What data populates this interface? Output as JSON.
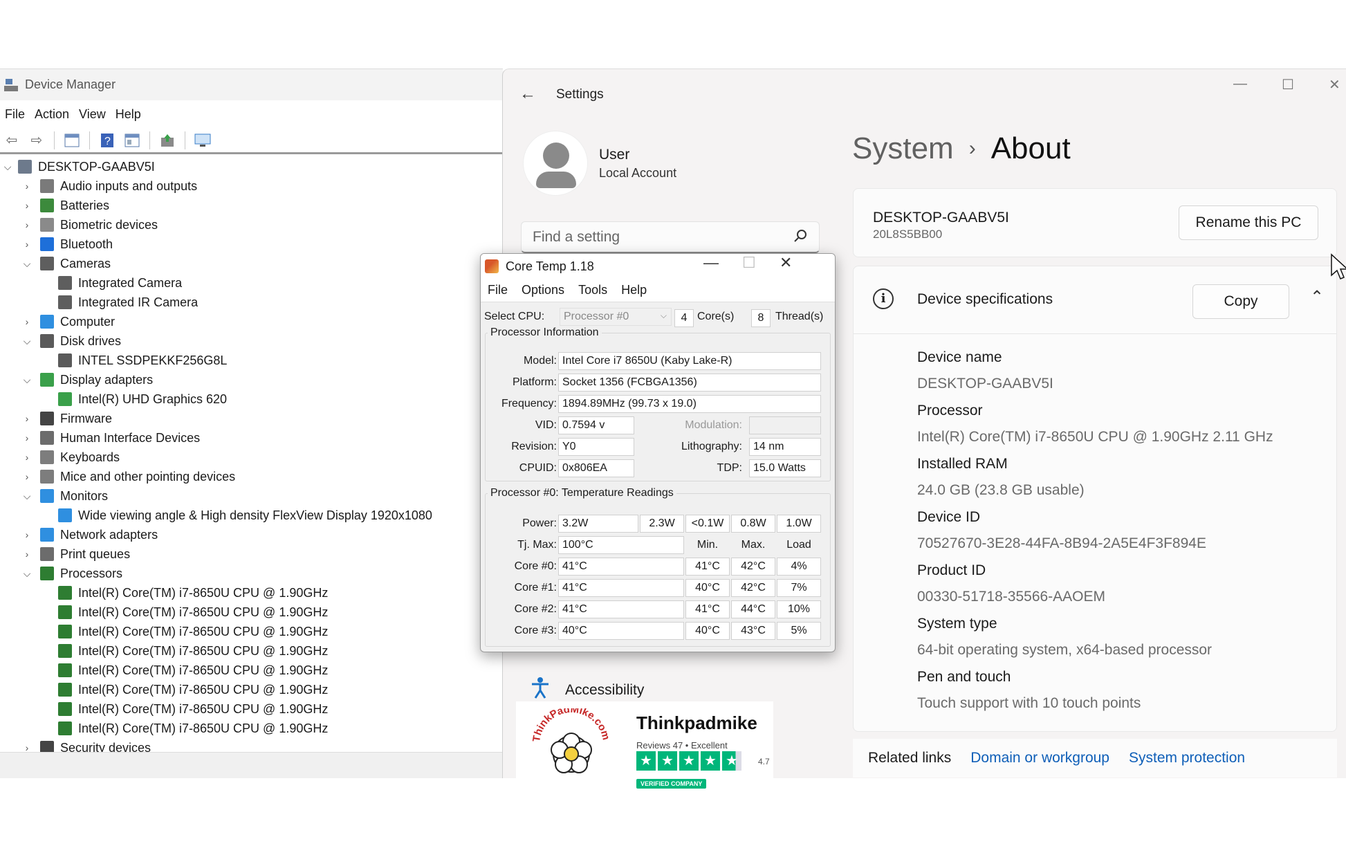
{
  "device_manager": {
    "title": "Device Manager",
    "menu": [
      "File",
      "Action",
      "View",
      "Help"
    ],
    "root": "DESKTOP-GAABV5I",
    "tree": [
      {
        "label": "Audio inputs and outputs",
        "level": 1,
        "state": "collapsed",
        "icon": "speaker-icon",
        "color": "#7a7a7a"
      },
      {
        "label": "Batteries",
        "level": 1,
        "state": "collapsed",
        "icon": "battery-icon",
        "color": "#3c8a3c"
      },
      {
        "label": "Biometric devices",
        "level": 1,
        "state": "collapsed",
        "icon": "fingerprint-icon",
        "color": "#8a8a8a"
      },
      {
        "label": "Bluetooth",
        "level": 1,
        "state": "collapsed",
        "icon": "bluetooth-icon",
        "color": "#1e6fd9"
      },
      {
        "label": "Cameras",
        "level": 1,
        "state": "expanded",
        "icon": "camera-icon",
        "color": "#5e5e5e"
      },
      {
        "label": "Integrated Camera",
        "level": 2,
        "state": "leaf",
        "icon": "camera-icon",
        "color": "#5e5e5e"
      },
      {
        "label": "Integrated IR Camera",
        "level": 2,
        "state": "leaf",
        "icon": "camera-icon",
        "color": "#5e5e5e"
      },
      {
        "label": "Computer",
        "level": 1,
        "state": "collapsed",
        "icon": "computer-icon",
        "color": "#2f8fe0"
      },
      {
        "label": "Disk drives",
        "level": 1,
        "state": "expanded",
        "icon": "disk-icon",
        "color": "#5a5a5a"
      },
      {
        "label": "INTEL SSDPEKKF256G8L",
        "level": 2,
        "state": "leaf",
        "icon": "disk-icon",
        "color": "#5a5a5a"
      },
      {
        "label": "Display adapters",
        "level": 1,
        "state": "expanded",
        "icon": "display-adapter-icon",
        "color": "#3aa04a"
      },
      {
        "label": "Intel(R) UHD Graphics 620",
        "level": 2,
        "state": "leaf",
        "icon": "display-adapter-icon",
        "color": "#3aa04a"
      },
      {
        "label": "Firmware",
        "level": 1,
        "state": "collapsed",
        "icon": "firmware-icon",
        "color": "#444444"
      },
      {
        "label": "Human Interface Devices",
        "level": 1,
        "state": "collapsed",
        "icon": "hid-icon",
        "color": "#6c6c6c"
      },
      {
        "label": "Keyboards",
        "level": 1,
        "state": "collapsed",
        "icon": "keyboard-icon",
        "color": "#7d7d7d"
      },
      {
        "label": "Mice and other pointing devices",
        "level": 1,
        "state": "collapsed",
        "icon": "mouse-icon",
        "color": "#7d7d7d"
      },
      {
        "label": "Monitors",
        "level": 1,
        "state": "expanded",
        "icon": "monitor-icon",
        "color": "#2f8fe0"
      },
      {
        "label": "Wide viewing angle & High density FlexView Display 1920x1080",
        "level": 2,
        "state": "leaf",
        "icon": "monitor-icon",
        "color": "#2f8fe0"
      },
      {
        "label": "Network adapters",
        "level": 1,
        "state": "collapsed",
        "icon": "network-icon",
        "color": "#2f8fe0"
      },
      {
        "label": "Print queues",
        "level": 1,
        "state": "collapsed",
        "icon": "printer-icon",
        "color": "#6c6c6c"
      },
      {
        "label": "Processors",
        "level": 1,
        "state": "expanded",
        "icon": "chip-icon",
        "color": "#2e7d32"
      },
      {
        "label": "Intel(R) Core(TM) i7-8650U CPU @ 1.90GHz",
        "level": 2,
        "state": "leaf",
        "icon": "chip-icon",
        "color": "#2e7d32"
      },
      {
        "label": "Intel(R) Core(TM) i7-8650U CPU @ 1.90GHz",
        "level": 2,
        "state": "leaf",
        "icon": "chip-icon",
        "color": "#2e7d32"
      },
      {
        "label": "Intel(R) Core(TM) i7-8650U CPU @ 1.90GHz",
        "level": 2,
        "state": "leaf",
        "icon": "chip-icon",
        "color": "#2e7d32"
      },
      {
        "label": "Intel(R) Core(TM) i7-8650U CPU @ 1.90GHz",
        "level": 2,
        "state": "leaf",
        "icon": "chip-icon",
        "color": "#2e7d32"
      },
      {
        "label": "Intel(R) Core(TM) i7-8650U CPU @ 1.90GHz",
        "level": 2,
        "state": "leaf",
        "icon": "chip-icon",
        "color": "#2e7d32"
      },
      {
        "label": "Intel(R) Core(TM) i7-8650U CPU @ 1.90GHz",
        "level": 2,
        "state": "leaf",
        "icon": "chip-icon",
        "color": "#2e7d32"
      },
      {
        "label": "Intel(R) Core(TM) i7-8650U CPU @ 1.90GHz",
        "level": 2,
        "state": "leaf",
        "icon": "chip-icon",
        "color": "#2e7d32"
      },
      {
        "label": "Intel(R) Core(TM) i7-8650U CPU @ 1.90GHz",
        "level": 2,
        "state": "leaf",
        "icon": "chip-icon",
        "color": "#2e7d32"
      },
      {
        "label": "Security devices",
        "level": 1,
        "state": "collapsed",
        "icon": "security-icon",
        "color": "#444444"
      }
    ]
  },
  "settings": {
    "title": "Settings",
    "user": {
      "name": "User",
      "account": "Local Account"
    },
    "search_placeholder": "Find a setting",
    "nav_visible": "Accessibility",
    "breadcrumb": {
      "parent": "System",
      "current": "About"
    },
    "pc": {
      "name": "DESKTOP-GAABV5I",
      "model": "20L8S5BB00",
      "rename_label": "Rename this PC"
    },
    "specs": {
      "title": "Device specifications",
      "copy_label": "Copy",
      "items": [
        {
          "label": "Device name",
          "value": "DESKTOP-GAABV5I"
        },
        {
          "label": "Processor",
          "value": "Intel(R) Core(TM) i7-8650U CPU @ 1.90GHz   2.11 GHz"
        },
        {
          "label": "Installed RAM",
          "value": "24.0 GB (23.8 GB usable)"
        },
        {
          "label": "Device ID",
          "value": "70527670-3E28-44FA-8B94-2A5E4F3F894E"
        },
        {
          "label": "Product ID",
          "value": "00330-51718-35566-AAOEM"
        },
        {
          "label": "System type",
          "value": "64-bit operating system, x64-based processor"
        },
        {
          "label": "Pen and touch",
          "value": "Touch support with 10 touch points"
        }
      ]
    },
    "related": {
      "label": "Related links",
      "links": [
        "Domain or workgroup",
        "System protection"
      ]
    }
  },
  "coretemp": {
    "title": "Core Temp 1.18",
    "menu": [
      "File",
      "Options",
      "Tools",
      "Help"
    ],
    "select_cpu_label": "Select CPU:",
    "cpu_selected": "Processor #0",
    "cores": "4",
    "cores_label": "Core(s)",
    "threads": "8",
    "threads_label": "Thread(s)",
    "info_group": "Processor Information",
    "model_label": "Model:",
    "model": "Intel Core i7 8650U (Kaby Lake-R)",
    "platform_label": "Platform:",
    "platform": "Socket 1356 (FCBGA1356)",
    "frequency_label": "Frequency:",
    "frequency": "1894.89MHz (99.73 x 19.0)",
    "vid_label": "VID:",
    "vid": "0.7594 v",
    "modulation_label": "Modulation:",
    "modulation": "",
    "revision_label": "Revision:",
    "revision": "Y0",
    "lithography_label": "Lithography:",
    "lithography": "14 nm",
    "cpuid_label": "CPUID:",
    "cpuid": "0x806EA",
    "tdp_label": "TDP:",
    "tdp": "15.0 Watts",
    "temp_group": "Processor #0: Temperature Readings",
    "power_label": "Power:",
    "power": [
      "3.2W",
      "2.3W",
      "<0.1W",
      "0.8W",
      "1.0W"
    ],
    "tjmax_label": "Tj. Max:",
    "tjmax": "100°C",
    "col_min": "Min.",
    "col_max": "Max.",
    "col_load": "Load",
    "cores_readings": [
      {
        "label": "Core #0:",
        "temp": "41°C",
        "min": "41°C",
        "max": "42°C",
        "load": "4%"
      },
      {
        "label": "Core #1:",
        "temp": "41°C",
        "min": "40°C",
        "max": "42°C",
        "load": "7%"
      },
      {
        "label": "Core #2:",
        "temp": "41°C",
        "min": "41°C",
        "max": "44°C",
        "load": "10%"
      },
      {
        "label": "Core #3:",
        "temp": "40°C",
        "min": "40°C",
        "max": "43°C",
        "load": "5%"
      }
    ]
  },
  "badge": {
    "logo_text": "ThinkPadMike.com",
    "name": "Thinkpadmike",
    "reviews": "Reviews 47  •  Excellent",
    "rating": "4.7",
    "verified": "VERIFIED COMPANY",
    "star_color": "#00b67a"
  }
}
